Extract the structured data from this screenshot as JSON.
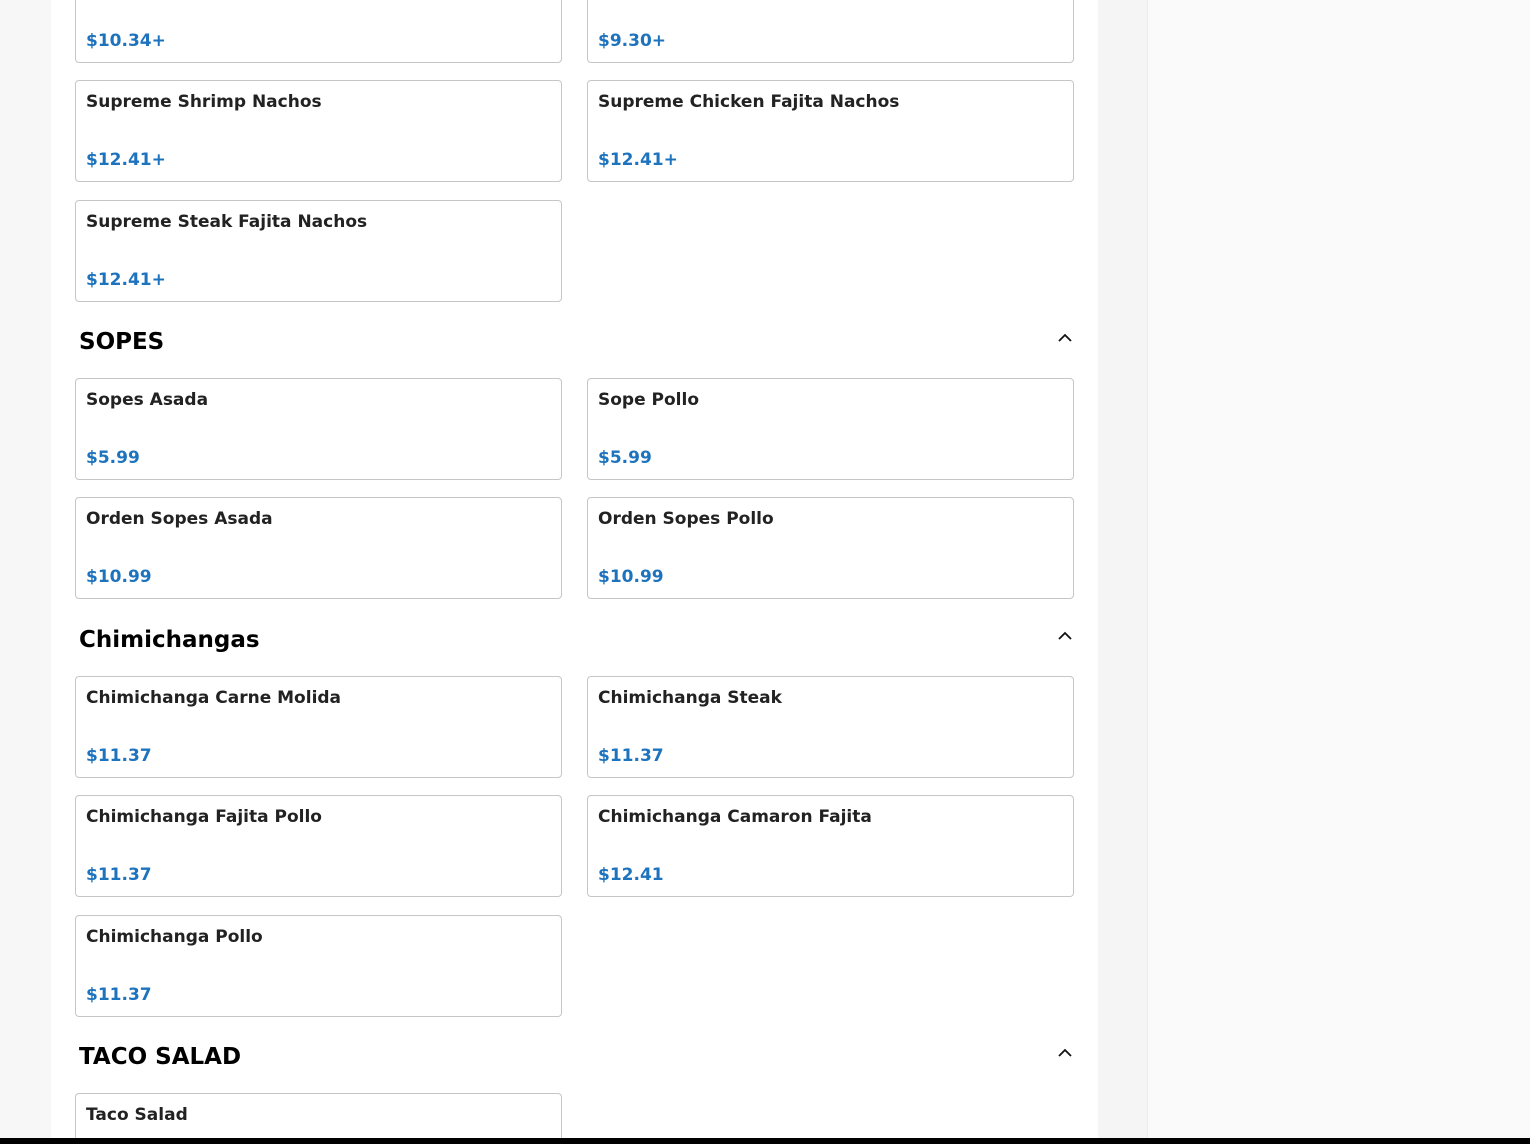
{
  "sections": {
    "nachos": {
      "items": [
        {
          "price": "$10.34+"
        },
        {
          "price": "$9.30+"
        },
        {
          "name": "Supreme Shrimp Nachos",
          "price": "$12.41+"
        },
        {
          "name": "Supreme Chicken Fajita Nachos",
          "price": "$12.41+"
        },
        {
          "name": "Supreme Steak Fajita Nachos",
          "price": "$12.41+"
        }
      ]
    },
    "sopes": {
      "title": "SOPES",
      "collapse_icon": "chevron-up-icon",
      "items": [
        {
          "name": "Sopes Asada",
          "price": "$5.99"
        },
        {
          "name": "Sope Pollo",
          "price": "$5.99"
        },
        {
          "name": "Orden Sopes Asada",
          "price": "$10.99"
        },
        {
          "name": "Orden Sopes Pollo",
          "price": "$10.99"
        }
      ]
    },
    "chimichangas": {
      "title": "Chimichangas",
      "collapse_icon": "chevron-up-icon",
      "items": [
        {
          "name": "Chimichanga Carne Molida",
          "price": "$11.37"
        },
        {
          "name": "Chimichanga Steak",
          "price": "$11.37"
        },
        {
          "name": "Chimichanga Fajita Pollo",
          "price": "$11.37"
        },
        {
          "name": "Chimichanga Camaron Fajita",
          "price": "$12.41"
        },
        {
          "name": "Chimichanga Pollo",
          "price": "$11.37"
        }
      ]
    },
    "taco_salad": {
      "title": "TACO SALAD",
      "collapse_icon": "chevron-up-icon",
      "items": [
        {
          "name": "Taco Salad"
        }
      ]
    }
  },
  "colors": {
    "price": "#1e73be",
    "card_border": "#c6c6c6",
    "heading": "#000000"
  }
}
